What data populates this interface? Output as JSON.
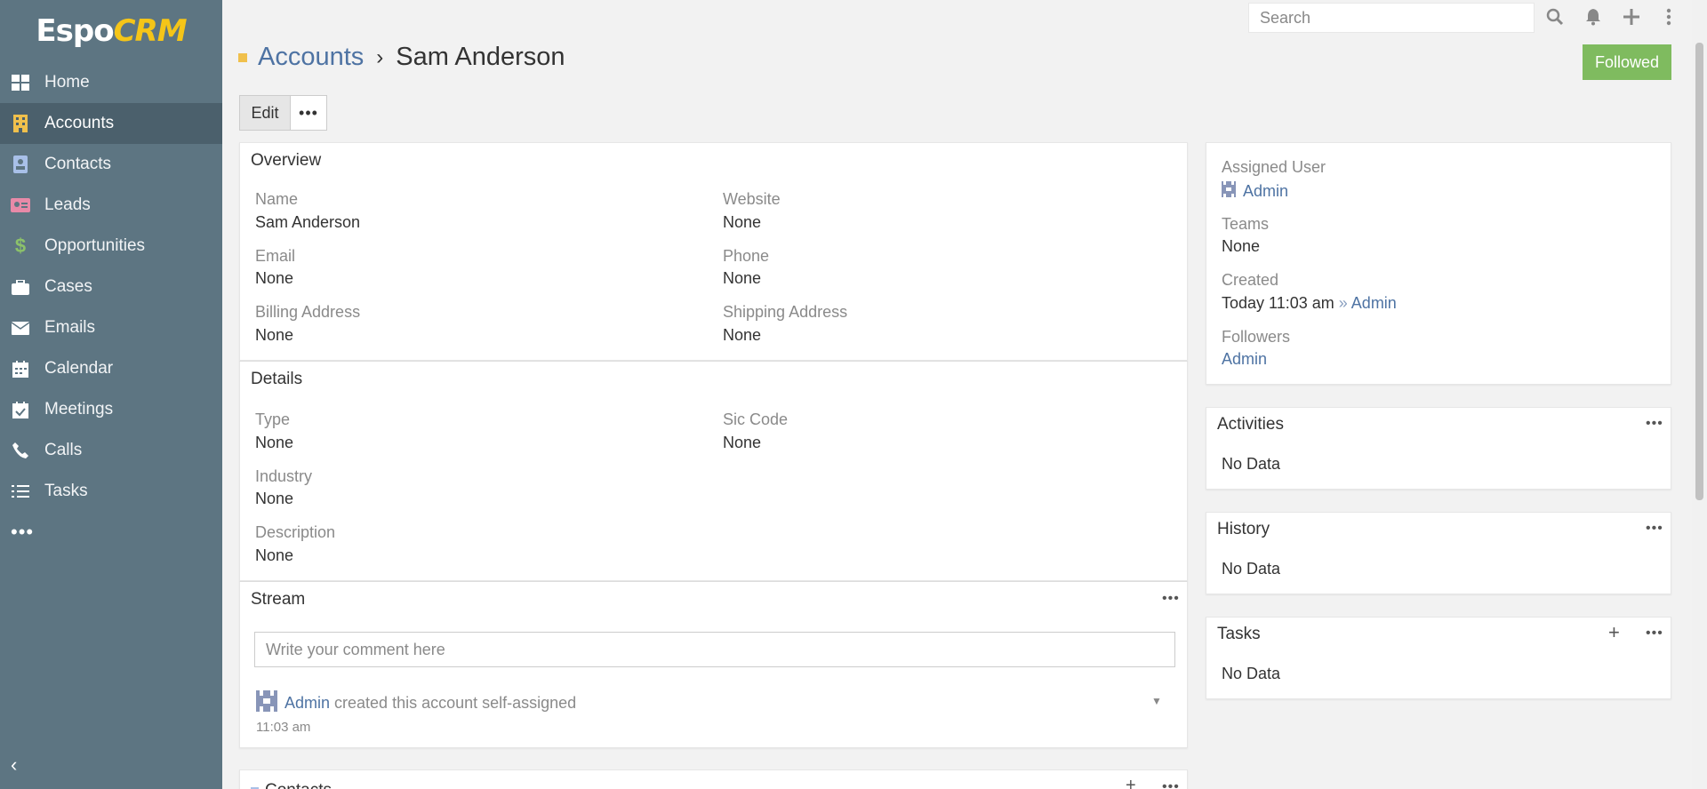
{
  "app": {
    "logo": "Espo",
    "logo_accent": "CRM"
  },
  "sidebar": {
    "items": [
      {
        "label": "Home",
        "icon": "home-grid-icon",
        "color": "#ffffff"
      },
      {
        "label": "Accounts",
        "icon": "building-icon",
        "color": "#f0c04c"
      },
      {
        "label": "Contacts",
        "icon": "contact-card-icon",
        "color": "#a8c0e8"
      },
      {
        "label": "Leads",
        "icon": "id-card-icon",
        "color": "#e88aa8"
      },
      {
        "label": "Opportunities",
        "icon": "dollar-icon",
        "color": "#8cc26a"
      },
      {
        "label": "Cases",
        "icon": "briefcase-icon",
        "color": "#ffffff"
      },
      {
        "label": "Emails",
        "icon": "envelope-icon",
        "color": "#ffffff"
      },
      {
        "label": "Calendar",
        "icon": "calendar-icon",
        "color": "#ffffff"
      },
      {
        "label": "Meetings",
        "icon": "calendar-check-icon",
        "color": "#ffffff"
      },
      {
        "label": "Calls",
        "icon": "phone-icon",
        "color": "#ffffff"
      },
      {
        "label": "Tasks",
        "icon": "task-list-icon",
        "color": "#ffffff"
      }
    ],
    "active": "Accounts",
    "more": "•••",
    "collapse": "‹"
  },
  "topbar": {
    "search_placeholder": "Search"
  },
  "header": {
    "breadcrumb": "Accounts",
    "separator": "›",
    "title": "Sam Anderson",
    "followed_label": "Followed"
  },
  "actions": {
    "edit_label": "Edit",
    "more_label": "•••"
  },
  "overview": {
    "title": "Overview",
    "name_label": "Name",
    "name_value": "Sam Anderson",
    "website_label": "Website",
    "website_value": "None",
    "email_label": "Email",
    "email_value": "None",
    "phone_label": "Phone",
    "phone_value": "None",
    "billing_label": "Billing Address",
    "billing_value": "None",
    "shipping_label": "Shipping Address",
    "shipping_value": "None"
  },
  "details": {
    "title": "Details",
    "type_label": "Type",
    "type_value": "None",
    "sic_label": "Sic Code",
    "sic_value": "None",
    "industry_label": "Industry",
    "industry_value": "None",
    "description_label": "Description",
    "description_value": "None"
  },
  "stream": {
    "title": "Stream",
    "comment_placeholder": "Write your comment here",
    "entry": {
      "user": "Admin",
      "text": "created this account self-assigned",
      "time": "11:03 am"
    }
  },
  "contacts_panel": {
    "title": "Contacts"
  },
  "side": {
    "assigned_user_label": "Assigned User",
    "assigned_user_value": "Admin",
    "teams_label": "Teams",
    "teams_value": "None",
    "created_label": "Created",
    "created_value": "Today 11:03 am",
    "created_sep": "»",
    "created_by": "Admin",
    "followers_label": "Followers",
    "followers_value": "Admin"
  },
  "activities": {
    "title": "Activities",
    "empty": "No Data"
  },
  "history": {
    "title": "History",
    "empty": "No Data"
  },
  "tasks": {
    "title": "Tasks",
    "empty": "No Data"
  },
  "colors": {
    "sidebar": "#5d7582",
    "sidebar_active": "#4b606c",
    "link": "#4e73a3",
    "followed": "#7fbb5f",
    "accounts_accent": "#f0c04c"
  }
}
